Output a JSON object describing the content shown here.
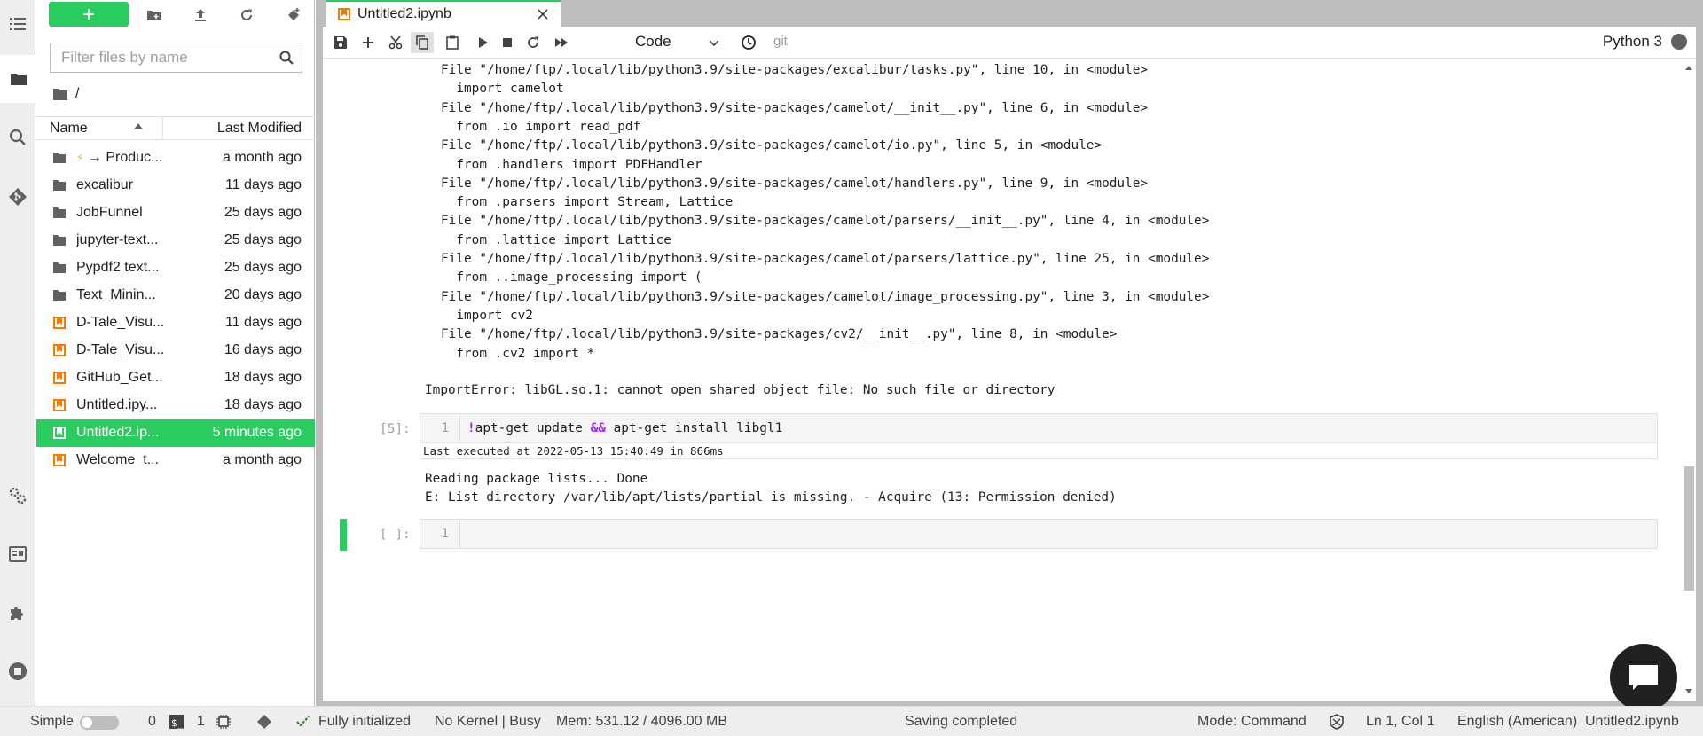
{
  "sidebar": {
    "icons": [
      "list-icon",
      "folder-icon",
      "search-icon",
      "git-icon",
      "settings-icon",
      "property-inspector-icon",
      "extension-icon",
      "stop-icon"
    ]
  },
  "filebrowser": {
    "new_label": "+",
    "filter_placeholder": "Filter files by name",
    "breadcrumb": "/",
    "col_name": "Name",
    "col_modified": "Last Modified",
    "items": [
      {
        "type": "folder",
        "bolt": "⚡",
        "name": "→ Produc...",
        "modified": "a month ago"
      },
      {
        "type": "folder",
        "name": "excalibur",
        "modified": "11 days ago"
      },
      {
        "type": "folder",
        "name": "JobFunnel",
        "modified": "25 days ago"
      },
      {
        "type": "folder",
        "name": "jupyter-text...",
        "modified": "25 days ago"
      },
      {
        "type": "folder",
        "name": "Pypdf2 text...",
        "modified": "25 days ago"
      },
      {
        "type": "folder",
        "name": "Text_Minin...",
        "modified": "20 days ago"
      },
      {
        "type": "notebook",
        "name": "D-Tale_Visu...",
        "modified": "11 days ago"
      },
      {
        "type": "notebook",
        "name": "D-Tale_Visu...",
        "modified": "16 days ago"
      },
      {
        "type": "notebook",
        "name": "GitHub_Get...",
        "modified": "18 days ago"
      },
      {
        "type": "notebook",
        "name": "Untitled.ipy...",
        "modified": "18 days ago"
      },
      {
        "type": "notebook",
        "name": "Untitled2.ip...",
        "modified": "5 minutes ago",
        "selected": true
      },
      {
        "type": "notebook",
        "name": "Welcome_t...",
        "modified": "a month ago"
      }
    ]
  },
  "tab": {
    "title": "Untitled2.ipynb"
  },
  "toolbar": {
    "cell_type": "Code",
    "git_label": "git",
    "kernel_name": "Python 3"
  },
  "traceback": [
    "File \"/home/ftp/.local/lib/python3.9/site-packages/excalibur/tasks.py\", line 10, in <module>",
    "  import camelot",
    "File \"/home/ftp/.local/lib/python3.9/site-packages/camelot/__init__.py\", line 6, in <module>",
    "  from .io import read_pdf",
    "File \"/home/ftp/.local/lib/python3.9/site-packages/camelot/io.py\", line 5, in <module>",
    "  from .handlers import PDFHandler",
    "File \"/home/ftp/.local/lib/python3.9/site-packages/camelot/handlers.py\", line 9, in <module>",
    "  from .parsers import Stream, Lattice",
    "File \"/home/ftp/.local/lib/python3.9/site-packages/camelot/parsers/__init__.py\", line 4, in <module>",
    "  from .lattice import Lattice",
    "File \"/home/ftp/.local/lib/python3.9/site-packages/camelot/parsers/lattice.py\", line 25, in <module>",
    "  from ..image_processing import (",
    "File \"/home/ftp/.local/lib/python3.9/site-packages/camelot/image_processing.py\", line 3, in <module>",
    "  import cv2",
    "File \"/home/ftp/.local/lib/python3.9/site-packages/cv2/__init__.py\", line 8, in <module>",
    "  from .cv2 import *"
  ],
  "import_error": "ImportError: libGL.so.1: cannot open shared object file: No such file or directory",
  "cell5": {
    "prompt": "[5]:",
    "line_no": "1",
    "bang": "!",
    "code_a": "apt-get update ",
    "op": "&&",
    "code_b": " apt-get install libgl1",
    "last_executed": "Last executed at 2022-05-13 15:40:49 in 866ms",
    "output": [
      "Reading package lists... Done",
      "E: List directory /var/lib/apt/lists/partial is missing. - Acquire (13: Permission denied)"
    ]
  },
  "cell_empty": {
    "prompt": "[ ]:",
    "line_no": "1"
  },
  "status": {
    "simple": "Simple",
    "terminals": "0",
    "kernels": "1",
    "init": "Fully initialized",
    "kernel_state": "No Kernel | Busy",
    "mem": "Mem: 531.12 / 4096.00 MB",
    "saving": "Saving completed",
    "mode": "Mode: Command",
    "position": "Ln 1, Col 1",
    "language": "English (American)",
    "filename": "Untitled2.ipynb"
  },
  "colors": {
    "accent": "#2bcc5f",
    "notebook_icon": "#f57c00"
  }
}
